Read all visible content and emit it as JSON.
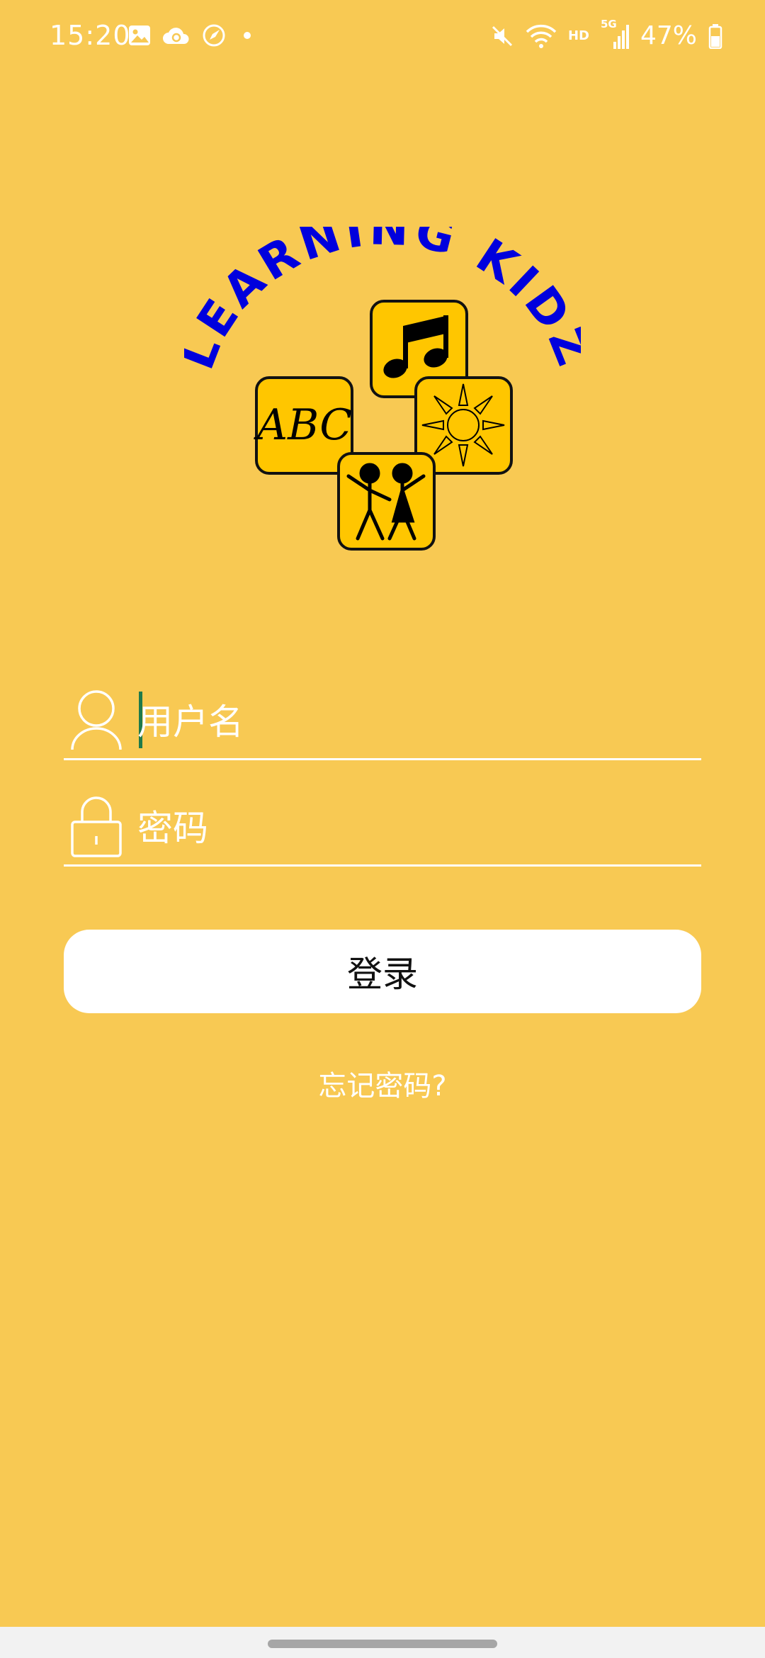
{
  "status_bar": {
    "time": "15:20",
    "battery": "47%",
    "network_hd": "HD",
    "network_5g": "5G",
    "left_icons": [
      "gallery-icon",
      "cloud-sync-icon",
      "compass-icon",
      "dot-icon"
    ],
    "right_icons": [
      "mute-icon",
      "wifi-icon",
      "signal-icon",
      "battery-icon"
    ]
  },
  "logo": {
    "text": "LEARNING KIDZ",
    "tiles": [
      "ABC",
      "music-note",
      "sun",
      "kids"
    ]
  },
  "login_form": {
    "username_placeholder": "用户名",
    "password_placeholder": "密码",
    "login_button": "登录",
    "forgot_password": "忘记密码?"
  },
  "colors": {
    "background": "#F8C953",
    "logo_text": "#0000DD",
    "tile_fill": "#FFC600",
    "cursor": "#1f7a4b"
  }
}
